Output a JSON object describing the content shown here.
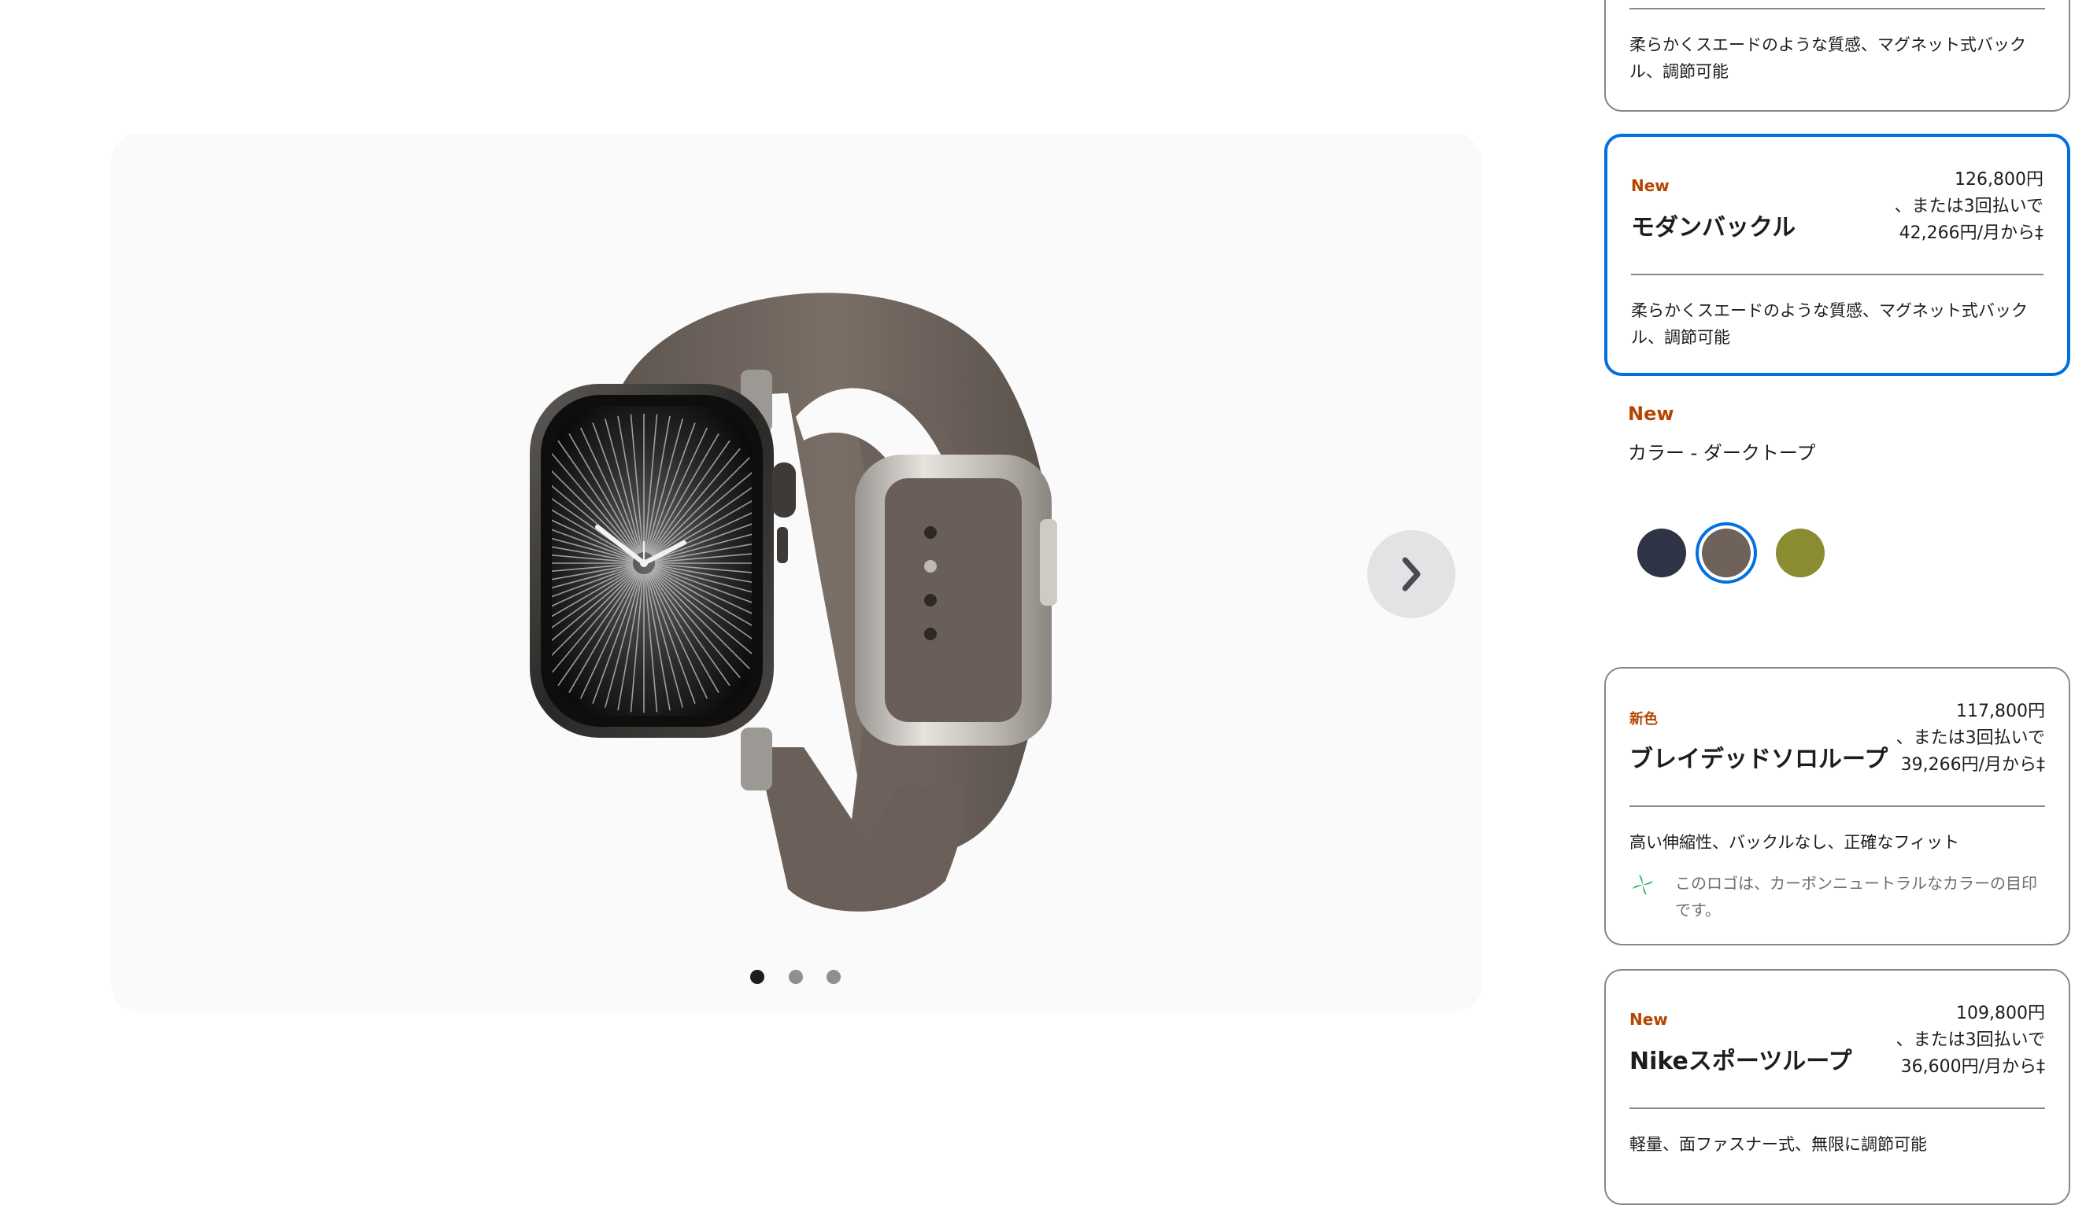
{
  "top_card": {
    "description": "柔らかくスエードのような質感、マグネット式バックル、調節可能"
  },
  "cards": [
    {
      "badge": "New",
      "name": "モダンバックル",
      "price": "126,800円",
      "installment_1": "、または3回払いで",
      "installment_2": "42,266円/月から‡",
      "description": "柔らかくスエードのような質感、マグネット式バックル、調節可能"
    },
    {
      "badge": "新色",
      "name": "ブレイデッドソロループ",
      "price": "117,800円",
      "installment_1": "、または3回払いで",
      "installment_2": "39,266円/月から‡",
      "description": "高い伸縮性、バックルなし、正確なフィット",
      "eco_note": "このロゴは、カーボンニュートラルなカラーの目印です。"
    },
    {
      "badge": "New",
      "name": "Nikeスポーツループ",
      "price": "109,800円",
      "installment_1": "、または3回払いで",
      "installment_2": "36,600円/月から‡",
      "description": "軽量、面ファスナー式、無限に調節可能"
    }
  ],
  "color_picker": {
    "badge": "New",
    "label": "カラー - ダークトープ",
    "swatches": [
      {
        "name": "midnight",
        "color": "#2e3445"
      },
      {
        "name": "dark-taupe",
        "color": "#6e625a",
        "selected": true
      },
      {
        "name": "olive",
        "color": "#8a8c32"
      }
    ]
  },
  "gallery": {
    "dots": 3,
    "active_dot": 0,
    "next_icon": "chevron-right-icon"
  },
  "colors": {
    "accent_blue": "#0071e3",
    "badge_orange": "#b64400",
    "card_border": "#86868b"
  }
}
